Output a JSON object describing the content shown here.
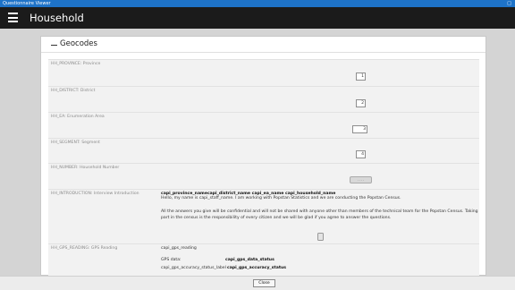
{
  "window": {
    "title": "Questionnaire Viewer",
    "restore_glyph": "□"
  },
  "header": {
    "title": "Household"
  },
  "section": {
    "title": "Geocodes"
  },
  "rows": [
    {
      "label": "HH_PROVINCE: Province",
      "value": "1"
    },
    {
      "label": "HH_DISTRICT: District",
      "value": "2"
    },
    {
      "label": "HH_EA: Enumeration Area",
      "value": "3"
    },
    {
      "label": "HH_SEGMENT: Segment",
      "value": "4"
    },
    {
      "label": "HH_NUMBER: Household Number",
      "value": ". . . ."
    }
  ],
  "intro": {
    "label": "HH_INTRODUCTION: Interview Introduction",
    "heading": "capi_province_namecapi_district_name capi_ea_name capi_household_name",
    "line1": "Hello, my name is capi_staff_name. I am working with Popstan Statistics and we are conducting the Popstan Census.",
    "line2": "All the answers you give will be confidential and will not be shared with anyone other than members of the technical team for the Popstan Census. Taking",
    "line3": "part in the census is the responsibility of every citizen and we will be glad if you agree to answer the questions."
  },
  "gps": {
    "label": "HH_GPS_READING: GPS Reading",
    "reading": "capi_gps_reading",
    "data_label": "GPS data:",
    "data_value": "capi_gps_data_status",
    "accuracy_label": "capi_gps_accuracy_status_label",
    "accuracy_value": "capi_gps_accuracy_status"
  },
  "footer": {
    "close_label": "Close"
  }
}
